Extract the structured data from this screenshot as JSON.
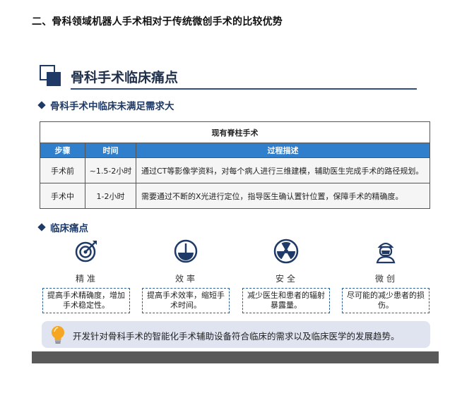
{
  "document": {
    "heading": "二、骨科领域机器人手术相对于传统微创手术的比较优势"
  },
  "slide": {
    "title": "骨科手术临床痛点",
    "section1_heading": "骨科手术中临床未满足需求大",
    "section2_heading": "临床痛点",
    "table": {
      "caption": "现有脊柱手术",
      "headers": [
        "步骤",
        "时间",
        "过程描述"
      ],
      "rows": [
        [
          "手术前",
          "~1.5-2小时",
          "通过CT等影像学资料，对每个病人进行三维建模，辅助医生完成手术的路径规划。"
        ],
        [
          "手术中",
          "1-2小时",
          "需要通过不断的X光进行定位，指导医生确认置针位置，保障手术的精确度。"
        ]
      ]
    },
    "pain_points": [
      {
        "icon": "target-icon",
        "label": "精准",
        "desc": "提高手术精确度，增加手术稳定性。"
      },
      {
        "icon": "gauge-icon",
        "label": "效率",
        "desc": "提高手术效率，缩短手术时间。"
      },
      {
        "icon": "radiation-icon",
        "label": "安全",
        "desc": "减少医生和患者的辐射暴露量。"
      },
      {
        "icon": "surgeon-icon",
        "label": "微创",
        "desc": "尽可能的减少患者的损伤。"
      }
    ],
    "tip": {
      "icon": "lightbulb-icon",
      "text": "开发针对骨科手术的智能化手术辅助设备符合临床的需求以及临床医学的发展趋势。"
    },
    "colors": {
      "primary": "#1f3a66",
      "table_header": "#2f7fcc",
      "tip_bg": "#dfe4f0",
      "bulb": "#f5a623",
      "band": "#595959"
    }
  }
}
